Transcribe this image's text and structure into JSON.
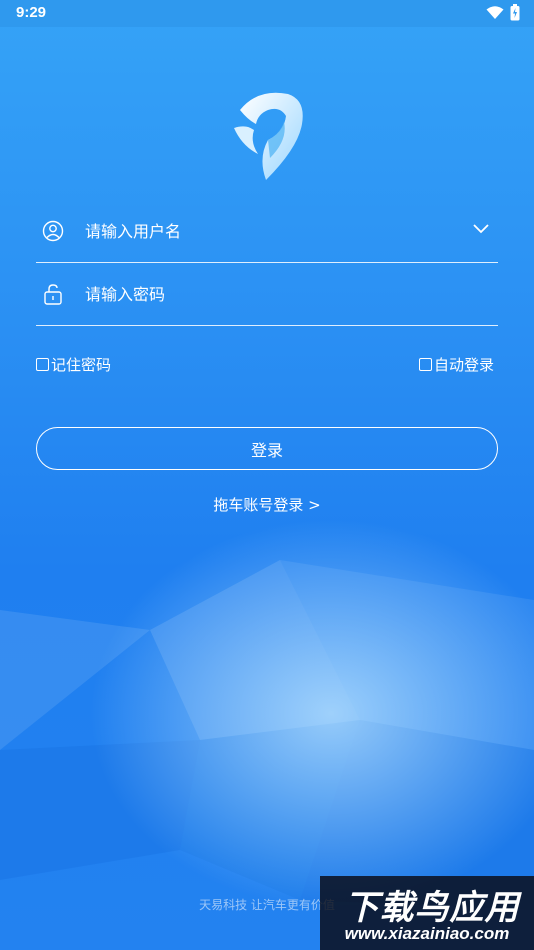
{
  "status": {
    "time": "9:29",
    "icons": [
      "wifi-icon",
      "battery-icon"
    ]
  },
  "login": {
    "username_placeholder": "请输入用户名",
    "password_placeholder": "请输入密码",
    "remember_label": "记住密码",
    "auto_login_label": "自动登录",
    "login_button": "登录",
    "tow_account_link": "拖车账号登录 >"
  },
  "footer": {
    "slogan": "天易科技 让汽车更有价值"
  },
  "watermark": {
    "title": "下载鸟应用",
    "url": "www.xiazainiao.com"
  },
  "colors": {
    "bg_top": "#35a3f7",
    "bg_bottom": "#2382f0",
    "text": "#ffffff"
  }
}
